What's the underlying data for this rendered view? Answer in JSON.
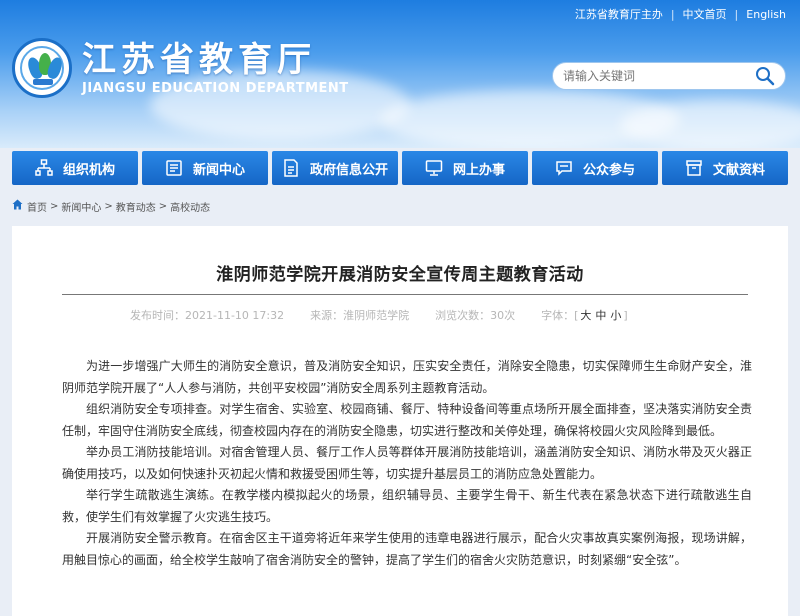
{
  "topbar": {
    "host": "江苏省教育厅主办",
    "lang_cn": "中文首页",
    "lang_en": "English"
  },
  "logo": {
    "cn": "江苏省教育厅",
    "en": "JIANGSU EDUCATION DEPARTMENT"
  },
  "search": {
    "placeholder": "请输入关键词"
  },
  "nav": {
    "items": [
      {
        "label": "组织机构",
        "icon": "org-chart-icon"
      },
      {
        "label": "新闻中心",
        "icon": "news-icon"
      },
      {
        "label": "政府信息公开",
        "icon": "document-icon"
      },
      {
        "label": "网上办事",
        "icon": "monitor-icon"
      },
      {
        "label": "公众参与",
        "icon": "chat-icon"
      },
      {
        "label": "文献资料",
        "icon": "archive-icon"
      }
    ]
  },
  "breadcrumb": {
    "home": "首页",
    "news": "新闻中心",
    "edu": "教育动态",
    "current": "高校动态"
  },
  "article": {
    "title": "淮阴师范学院开展消防安全宣传周主题教育活动",
    "time_label": "发布时间：",
    "time": "2021-11-10 17:32",
    "source_label": "来源：",
    "source": "淮阴师范学院",
    "views_label": "浏览次数：",
    "views": "30次",
    "font_label": "字体：",
    "font_big": "大",
    "font_mid": "中",
    "font_small": "小",
    "paragraphs": [
      "为进一步增强广大师生的消防安全意识，普及消防安全知识，压实安全责任，消除安全隐患，切实保障师生生命财产安全，淮阴师范学院开展了“人人参与消防，共创平安校园”消防安全周系列主题教育活动。",
      "组织消防安全专项排查。对学生宿舍、实验室、校园商铺、餐厅、特种设备间等重点场所开展全面排查，坚决落实消防安全责任制，牢固守住消防安全底线，彻查校园内存在的消防安全隐患，切实进行整改和关停处理，确保将校园火灾风险降到最低。",
      "举办员工消防技能培训。对宿舍管理人员、餐厅工作人员等群体开展消防技能培训，涵盖消防安全知识、消防水带及灭火器正确使用技巧，以及如何快速扑灭初起火情和救援受困师生等，切实提升基层员工的消防应急处置能力。",
      "举行学生疏散逃生演练。在教学楼内模拟起火的场景，组织辅导员、主要学生骨干、新生代表在紧急状态下进行疏散逃生自救，使学生们有效掌握了火灾逃生技巧。",
      "开展消防安全警示教育。在宿舍区主干道旁将近年来学生使用的违章电器进行展示，配合火灾事故真实案例海报，现场讲解，用触目惊心的画面，给全校学生敲响了宿舍消防安全的警钟，提高了学生们的宿舍火灾防范意识，时刻紧绷“安全弦”。"
    ]
  },
  "colors": {
    "nav_blue": "#1e78d8",
    "header_top": "#1e7de0"
  }
}
